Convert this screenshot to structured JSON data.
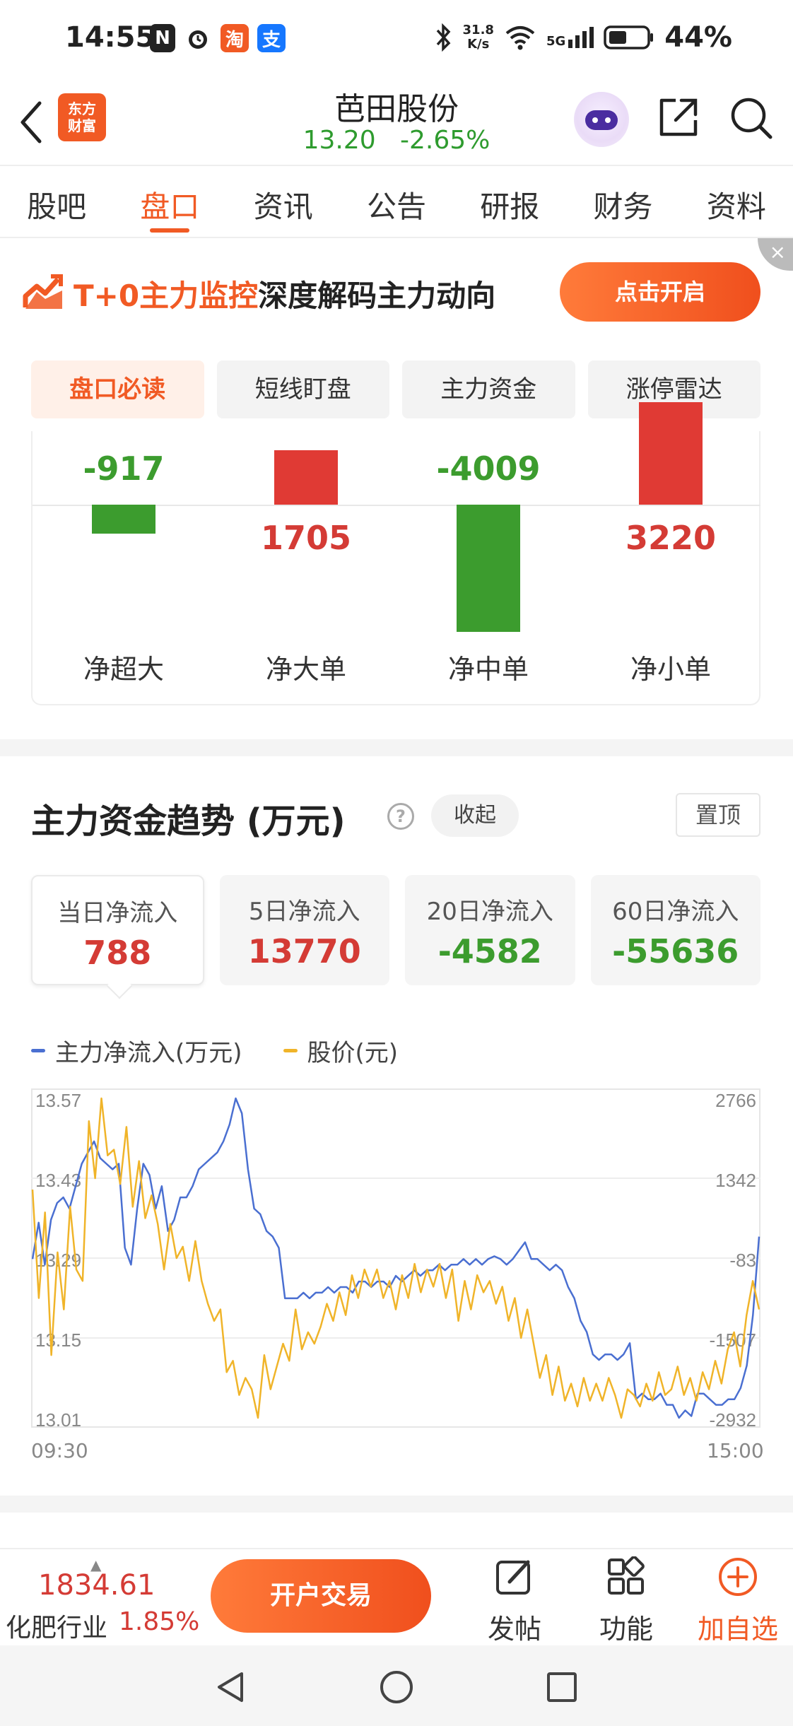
{
  "status_bar": {
    "time": "14:55",
    "net_speed_value": "31.8",
    "net_speed_unit": "K/s",
    "network": "5G",
    "battery": "44%"
  },
  "header": {
    "logo_line1": "东方",
    "logo_line2": "财富",
    "stock_name": "芭田股份",
    "price": "13.20",
    "change": "-2.65%"
  },
  "tabs": [
    {
      "label": "股吧"
    },
    {
      "label": "盘口"
    },
    {
      "label": "资讯"
    },
    {
      "label": "公告"
    },
    {
      "label": "研报"
    },
    {
      "label": "财务"
    },
    {
      "label": "资料"
    }
  ],
  "banner": {
    "highlight": "T+0主力监控",
    "text": "深度解码主力动向",
    "button": "点击开启",
    "close": "×"
  },
  "subtabs": [
    {
      "label": "盘口必读"
    },
    {
      "label": "短线盯盘"
    },
    {
      "label": "主力资金"
    },
    {
      "label": "涨停雷达"
    }
  ],
  "net_flow": [
    {
      "label": "净超大",
      "value": "-917",
      "amount": -917
    },
    {
      "label": "净大单",
      "value": "1705",
      "amount": 1705
    },
    {
      "label": "净中单",
      "value": "-4009",
      "amount": -4009
    },
    {
      "label": "净小单",
      "value": "3220",
      "amount": 3220
    }
  ],
  "trend": {
    "title": "主力资金趋势 (万元)",
    "help": "?",
    "collapse": "收起",
    "pin": "置顶",
    "periods": [
      {
        "label": "当日净流入",
        "value": "788"
      },
      {
        "label": "5日净流入",
        "value": "13770"
      },
      {
        "label": "20日净流入",
        "value": "-4582"
      },
      {
        "label": "60日净流入",
        "value": "-55636"
      }
    ],
    "legend": [
      {
        "label": "主力净流入(万元)",
        "color": "#4a6fd1"
      },
      {
        "label": "股价(元)",
        "color": "#f0b429"
      }
    ]
  },
  "chart_data": {
    "type": "line",
    "x_start": "09:30",
    "x_end": "15:00",
    "left_axis": {
      "ticks": [
        "13.57",
        "13.43",
        "13.29",
        "13.15",
        "13.01"
      ],
      "range": [
        13.01,
        13.57
      ]
    },
    "right_axis": {
      "ticks": [
        "2766",
        "1342",
        "-83",
        "-1507",
        "-2932"
      ],
      "range": [
        -2932,
        2766
      ]
    },
    "series": [
      {
        "name": "主力净流入(万元)",
        "color": "#4a6fd1",
        "axis": "right",
        "values": [
          -100,
          550,
          -200,
          600,
          900,
          1000,
          800,
          1200,
          1600,
          1800,
          2000,
          1700,
          1600,
          1500,
          1600,
          100,
          -200,
          800,
          1600,
          1400,
          800,
          1200,
          400,
          600,
          1000,
          1000,
          1200,
          1500,
          1600,
          1700,
          1800,
          2000,
          2300,
          2766,
          2500,
          1500,
          800,
          700,
          400,
          300,
          100,
          -800,
          -800,
          -800,
          -700,
          -800,
          -700,
          -700,
          -600,
          -700,
          -600,
          -600,
          -700,
          -500,
          -500,
          -600,
          -500,
          -500,
          -600,
          -400,
          -500,
          -400,
          -300,
          -400,
          -300,
          -300,
          -200,
          -300,
          -200,
          -200,
          -100,
          -200,
          -100,
          -200,
          -100,
          -50,
          -100,
          -200,
          -100,
          50,
          200,
          -100,
          -100,
          -200,
          -300,
          -200,
          -300,
          -600,
          -800,
          -1200,
          -1400,
          -1800,
          -1900,
          -1800,
          -1800,
          -1900,
          -1800,
          -1600,
          -2600,
          -2500,
          -2600,
          -2600,
          -2500,
          -2700,
          -2700,
          -2932,
          -2800,
          -2900,
          -2500,
          -2500,
          -2600,
          -2700,
          -2700,
          -2600,
          -2600,
          -2400,
          -2000,
          -1100,
          300
        ]
      },
      {
        "name": "股价(元)",
        "color": "#f0b429",
        "axis": "left",
        "values": [
          13.41,
          13.22,
          13.37,
          13.12,
          13.3,
          13.2,
          13.38,
          13.27,
          13.25,
          13.53,
          13.43,
          13.57,
          13.47,
          13.48,
          13.42,
          13.52,
          13.38,
          13.46,
          13.36,
          13.4,
          13.35,
          13.27,
          13.35,
          13.29,
          13.31,
          13.25,
          13.32,
          13.25,
          13.21,
          13.18,
          13.2,
          13.09,
          13.11,
          13.05,
          13.08,
          13.06,
          13.01,
          13.12,
          13.06,
          13.1,
          13.14,
          13.11,
          13.2,
          13.13,
          13.16,
          13.14,
          13.17,
          13.21,
          13.18,
          13.23,
          13.19,
          13.26,
          13.22,
          13.27,
          13.24,
          13.27,
          13.22,
          13.25,
          13.2,
          13.26,
          13.22,
          13.28,
          13.23,
          13.27,
          13.24,
          13.28,
          13.22,
          13.27,
          13.18,
          13.25,
          13.2,
          13.26,
          13.23,
          13.25,
          13.21,
          13.24,
          13.18,
          13.22,
          13.15,
          13.2,
          13.14,
          13.08,
          13.12,
          13.05,
          13.1,
          13.04,
          13.07,
          13.03,
          13.08,
          13.04,
          13.07,
          13.04,
          13.08,
          13.05,
          13.01,
          13.06,
          13.05,
          13.03,
          13.07,
          13.04,
          13.09,
          13.05,
          13.06,
          13.1,
          13.05,
          13.08,
          13.04,
          13.09,
          13.06,
          13.11,
          13.07,
          13.13,
          13.16,
          13.1,
          13.19,
          13.25,
          13.2
        ]
      }
    ]
  },
  "bottom_bar": {
    "index_value": "1834.61",
    "index_name": "化肥行业",
    "index_change": "1.85%",
    "trade_button": "开户交易",
    "post": "发帖",
    "function": "功能",
    "add_watch": "加自选"
  }
}
